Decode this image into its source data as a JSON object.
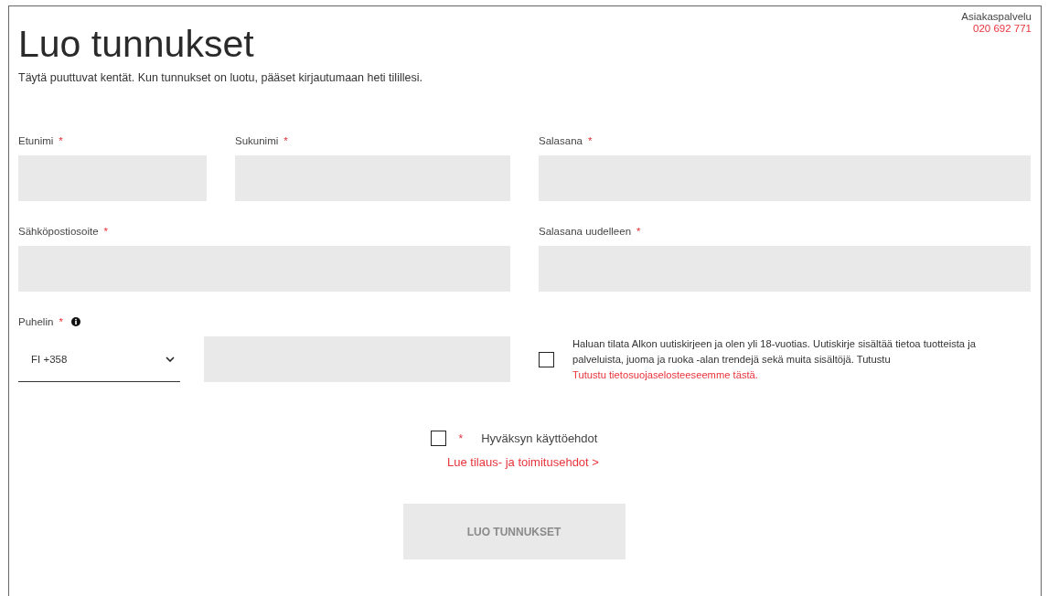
{
  "header": {
    "title": "Luo tunnukset",
    "intro": "Täytä puuttuvat kentät. Kun tunnukset on luotu, pääset kirjautumaan heti tilillesi.",
    "service_label": "Asiakaspalvelu",
    "service_phone": "020 692 771"
  },
  "first_name": {
    "label": "Etunimi",
    "required_mark": "*"
  },
  "last_name": {
    "label": "Sukunimi",
    "required_mark": "*"
  },
  "email": {
    "label": "Sähköpostiosoite",
    "required_mark": "*"
  },
  "password": {
    "label": "Salasana",
    "required_mark": "*"
  },
  "password_again": {
    "label": "Salasana uudelleen",
    "required_mark": "*"
  },
  "phone": {
    "label": "Puhelin",
    "required_mark": "*",
    "country_code": "FI +358"
  },
  "newsletter": {
    "checked": false,
    "text": "Haluan tilata Alkon uutiskirjeen ja olen yli 18-vuotias. Uutiskirje sisältää tietoa tuotteista ja palveluista, juoma ja ruoka -alan trendejä sekä muita sisältöjä. Tutustu ",
    "link": "Tutustu tietosuojaselosteeseemme tästä."
  },
  "terms": {
    "checked": false,
    "required_mark": "*",
    "label": "Hyväksyn käyttöehdot",
    "link": "Lue tilaus- ja toimitusehdot >"
  },
  "submit": {
    "label": "LUO TUNNUKSET",
    "disabled": true
  }
}
